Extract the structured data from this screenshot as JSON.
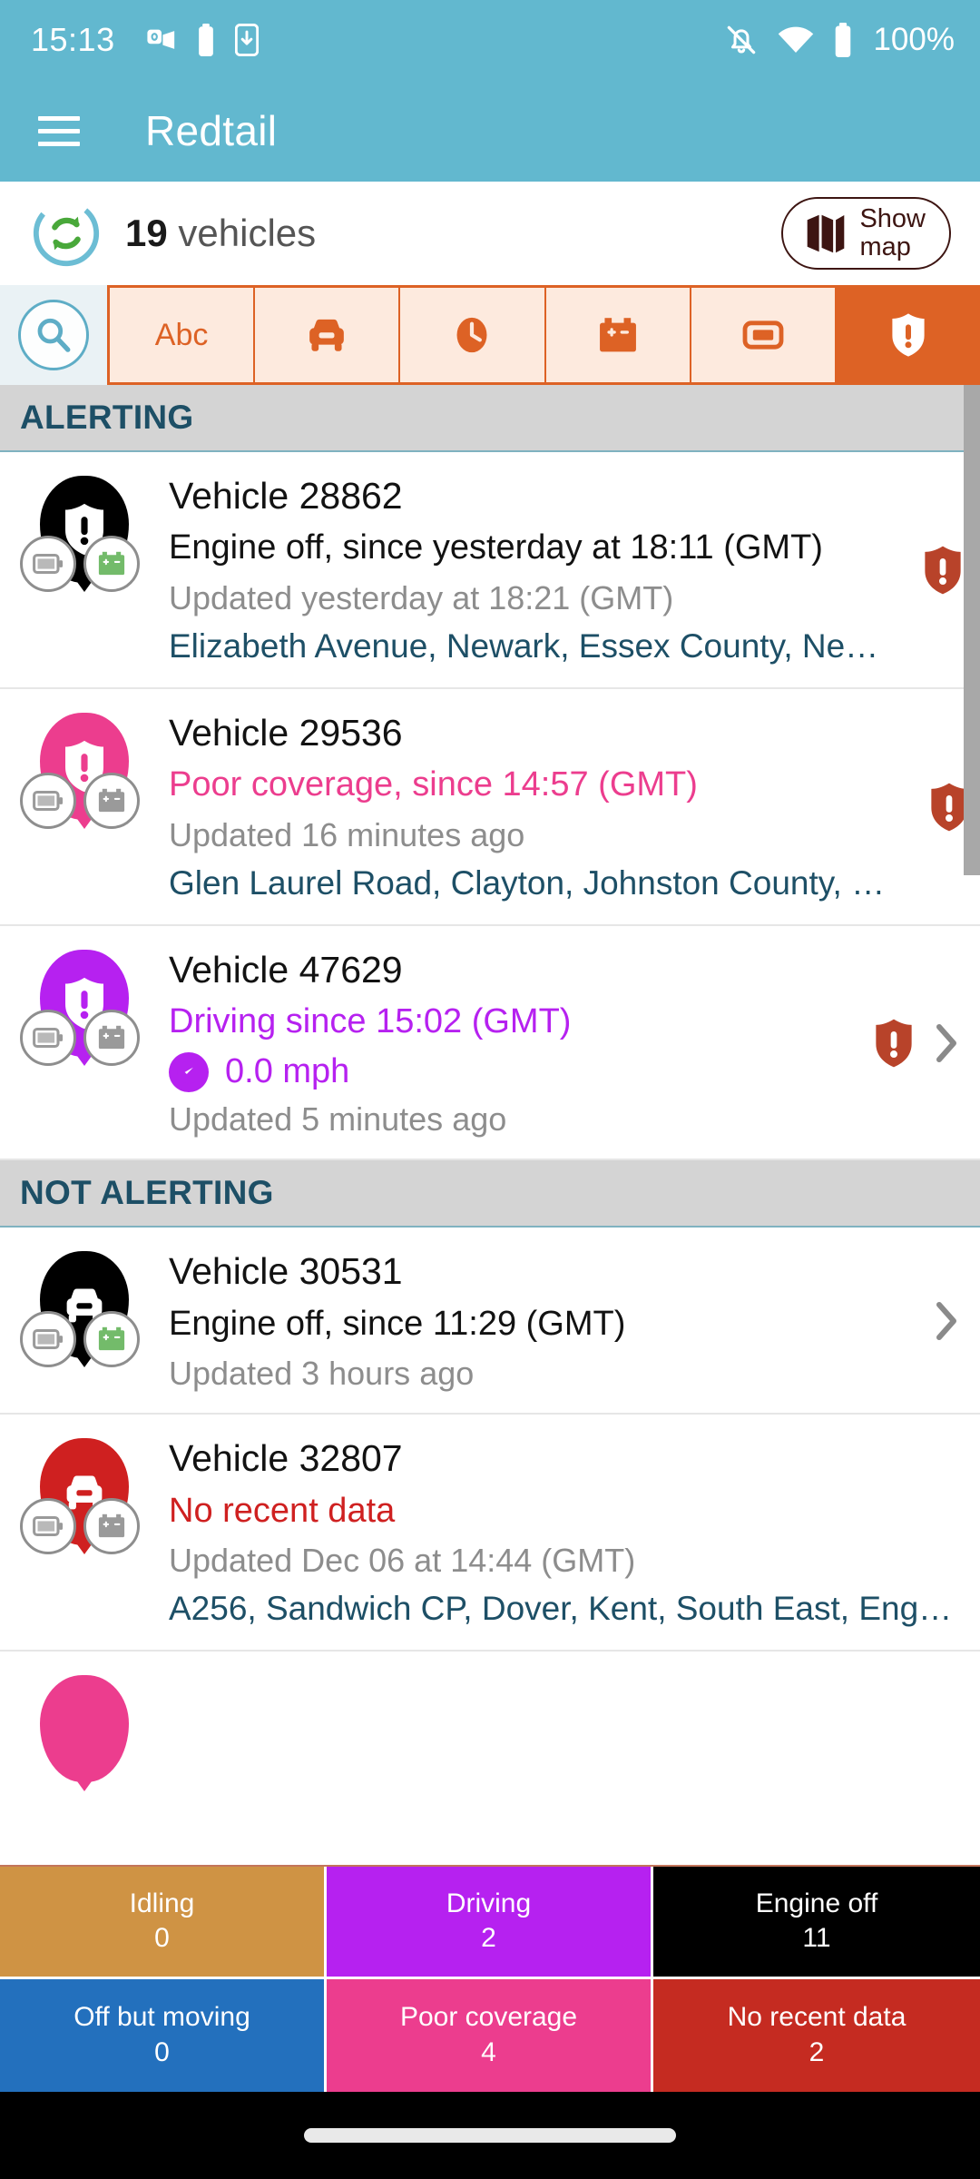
{
  "status_bar": {
    "time": "15:13",
    "battery_percent": "100%",
    "icons": [
      "outlook-icon",
      "battery-icon",
      "phone-download-icon",
      "bell-muted-icon",
      "wifi-icon",
      "battery-full-icon"
    ]
  },
  "app_bar": {
    "menu_icon": "hamburger-menu-icon",
    "title": "Redtail"
  },
  "count_bar": {
    "refresh_icon": "refresh-icon",
    "count": "19",
    "count_label": "vehicles",
    "show_map_icon": "map-icon",
    "show_map_line1": "Show",
    "show_map_line2": "map"
  },
  "filters": {
    "search_icon": "search-icon",
    "tabs": [
      {
        "icon": "abc-text-icon",
        "label": "Abc",
        "active": false
      },
      {
        "icon": "car-icon",
        "label": "",
        "active": false
      },
      {
        "icon": "clock-icon",
        "label": "",
        "active": false
      },
      {
        "icon": "car-battery-icon",
        "label": "",
        "active": false
      },
      {
        "icon": "device-icon",
        "label": "",
        "active": false
      },
      {
        "icon": "shield-alert-icon",
        "label": "",
        "active": true
      }
    ]
  },
  "sections": [
    {
      "title": "ALERTING",
      "rows": [
        {
          "pin_color": "#000000",
          "pin_icon": "shield-alert-icon",
          "badges": [
            {
              "icon": "battery-icon",
              "color": "#9a9a9a"
            },
            {
              "icon": "car-battery-icon",
              "color": "#73bb6a"
            }
          ],
          "title": "Vehicle 28862",
          "status": "Engine off, since yesterday at 18:11 (GMT)",
          "status_color": "#121212",
          "updated": "Updated yesterday at 18:21 (GMT)",
          "address": "Elizabeth Avenue, Newark, Essex County, Ne…",
          "speed": "",
          "alert_icon": "shield-alert-icon",
          "alert_color": "#b8432a",
          "chevron": "chevron-right-icon"
        },
        {
          "pin_color": "#ec3d8e",
          "pin_icon": "shield-alert-icon",
          "badges": [
            {
              "icon": "battery-icon",
              "color": "#9a9a9a"
            },
            {
              "icon": "car-battery-icon",
              "color": "#9a9a9a"
            }
          ],
          "title": "Vehicle 29536",
          "status": "Poor coverage, since 14:57 (GMT)",
          "status_color": "#ec3d8e",
          "updated": "Updated 16 minutes ago",
          "address": "Glen Laurel Road, Clayton, Johnston County, …",
          "speed": "",
          "alert_icon": "shield-alert-icon",
          "alert_color": "#b8432a",
          "chevron": "chevron-right-icon"
        },
        {
          "pin_color": "#b621f0",
          "pin_icon": "shield-alert-icon",
          "badges": [
            {
              "icon": "battery-icon",
              "color": "#9a9a9a"
            },
            {
              "icon": "car-battery-icon",
              "color": "#9a9a9a"
            }
          ],
          "title": "Vehicle 47629",
          "status": "Driving since 15:02 (GMT)",
          "status_color": "#b621f0",
          "speed": "0.0 mph",
          "speed_icon": "speedometer-icon",
          "updated": "Updated 5 minutes ago",
          "address": "",
          "alert_icon": "shield-alert-icon",
          "alert_color": "#b8432a",
          "chevron": "chevron-right-icon"
        }
      ]
    },
    {
      "title": "NOT ALERTING",
      "rows": [
        {
          "pin_color": "#000000",
          "pin_icon": "car-icon",
          "badges": [
            {
              "icon": "battery-icon",
              "color": "#9a9a9a"
            },
            {
              "icon": "car-battery-icon",
              "color": "#73bb6a"
            }
          ],
          "title": "Vehicle 30531",
          "status": "Engine off, since 11:29 (GMT)",
          "status_color": "#121212",
          "updated": "Updated 3 hours ago",
          "address": "",
          "speed": "",
          "alert_icon": "",
          "chevron": "chevron-right-icon"
        },
        {
          "pin_color": "#cf2020",
          "pin_icon": "car-icon",
          "badges": [
            {
              "icon": "battery-icon",
              "color": "#9a9a9a"
            },
            {
              "icon": "car-battery-icon",
              "color": "#9a9a9a"
            }
          ],
          "title": "Vehicle 32807",
          "status": "No recent data",
          "status_color": "#cf2020",
          "updated": "Updated Dec 06 at 14:44 (GMT)",
          "address": "A256, Sandwich CP, Dover, Kent, South East, Eng…",
          "speed": "",
          "alert_icon": "",
          "chevron": "chevron-right-icon"
        }
      ]
    }
  ],
  "summary": [
    {
      "label": "Idling",
      "value": "0",
      "color": "#cf9344"
    },
    {
      "label": "Driving",
      "value": "2",
      "color": "#b621f0"
    },
    {
      "label": "Engine off",
      "value": "11",
      "color": "#000000"
    },
    {
      "label": "Off but moving",
      "value": "0",
      "color": "#2370bd"
    },
    {
      "label": "Poor coverage",
      "value": "4",
      "color": "#ec3d8e"
    },
    {
      "label": "No recent data",
      "value": "2",
      "color": "#c52b21"
    }
  ],
  "colors": {
    "brand": "#62b8cf",
    "accent": "#dd6225",
    "section_header_bg": "#d4d4d4",
    "section_header_text": "#1d4f66",
    "address_text": "#1d4f66"
  }
}
